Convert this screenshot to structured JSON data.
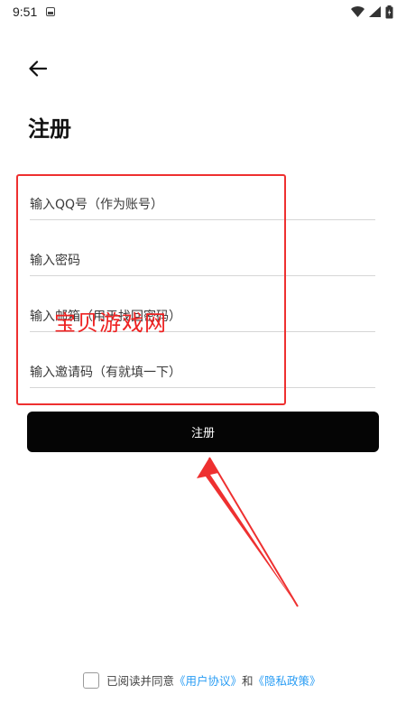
{
  "status_bar": {
    "time": "9:51",
    "icons": [
      "notification-icon",
      "wifi-icon",
      "signal-icon",
      "battery-icon"
    ]
  },
  "header": {
    "back_icon": "arrow-left-icon",
    "title": "注册"
  },
  "form": {
    "fields": [
      {
        "name": "qq",
        "placeholder": "输入QQ号（作为账号）",
        "value": ""
      },
      {
        "name": "password",
        "placeholder": "输入密码",
        "value": ""
      },
      {
        "name": "email",
        "placeholder": "输入邮箱（用于找回密码）",
        "value": ""
      },
      {
        "name": "invite",
        "placeholder": "输入邀请码（有就填一下）",
        "value": ""
      }
    ],
    "submit_label": "注册"
  },
  "overlay": {
    "watermark": "宝贝游戏网",
    "annotation_color": "#ee3030"
  },
  "agreement": {
    "checked": false,
    "prefix": "已阅读并同意",
    "user_agreement": "《用户协议》",
    "and": "和",
    "privacy_policy": "《隐私政策》"
  },
  "colors": {
    "button_bg": "#050505",
    "link": "#2a9df4",
    "annotation": "#ee3030"
  }
}
